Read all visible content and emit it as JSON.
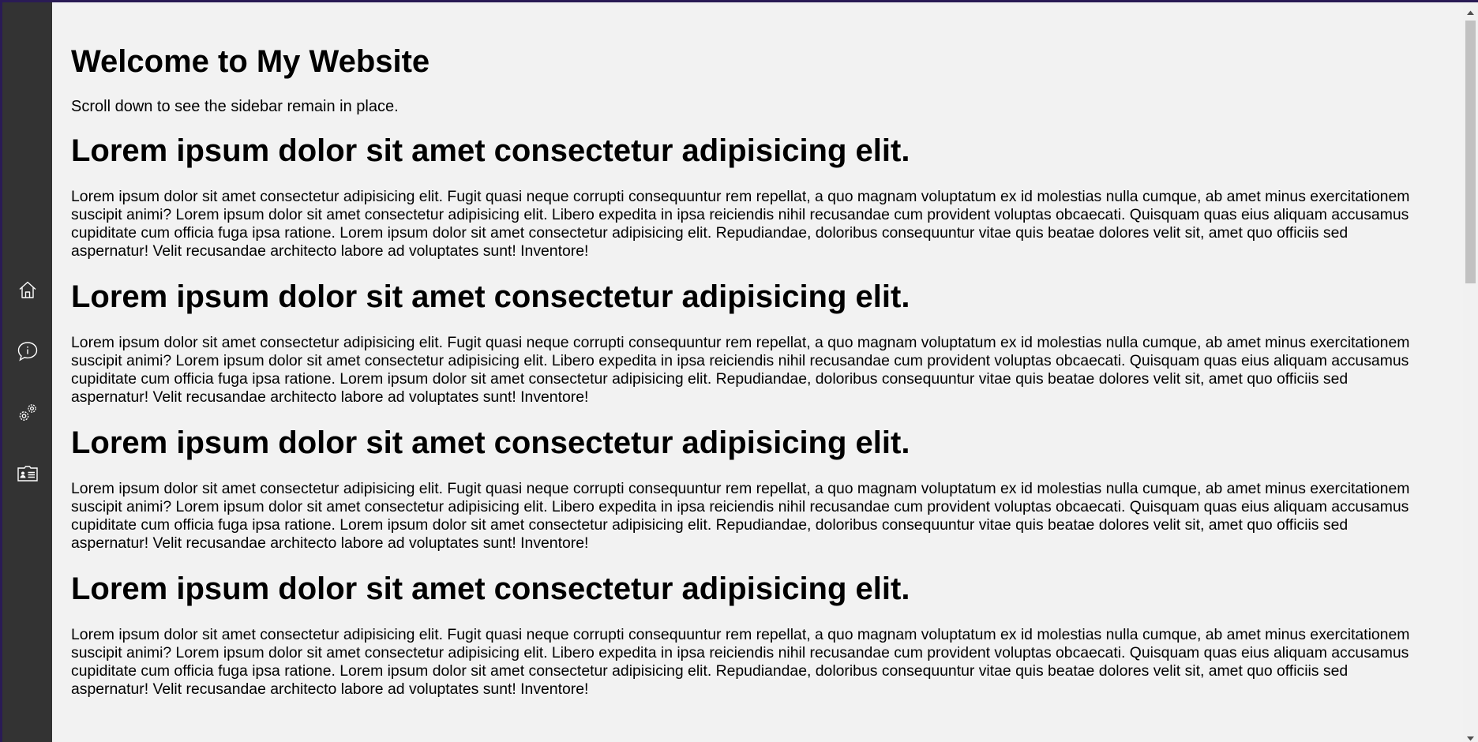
{
  "page": {
    "title": "Welcome to My Website",
    "intro": "Scroll down to see the sidebar remain in place."
  },
  "sidebar": {
    "items": [
      {
        "icon": "home-icon"
      },
      {
        "icon": "info-icon"
      },
      {
        "icon": "gears-icon"
      },
      {
        "icon": "contact-card-icon"
      }
    ]
  },
  "sections": [
    {
      "heading": "Lorem ipsum dolor sit amet consectetur adipisicing elit.",
      "body": "Lorem ipsum dolor sit amet consectetur adipisicing elit. Fugit quasi neque corrupti consequuntur rem repellat, a quo magnam voluptatum ex id molestias nulla cumque, ab amet minus exercitationem suscipit animi? Lorem ipsum dolor sit amet consectetur adipisicing elit. Libero expedita in ipsa reiciendis nihil recusandae cum provident voluptas obcaecati. Quisquam quas eius aliquam accusamus cupiditate cum officia fuga ipsa ratione. Lorem ipsum dolor sit amet consectetur adipisicing elit. Repudiandae, doloribus consequuntur vitae quis beatae dolores velit sit, amet quo officiis sed aspernatur! Velit recusandae architecto labore ad voluptates sunt! Inventore!"
    },
    {
      "heading": "Lorem ipsum dolor sit amet consectetur adipisicing elit.",
      "body": "Lorem ipsum dolor sit amet consectetur adipisicing elit. Fugit quasi neque corrupti consequuntur rem repellat, a quo magnam voluptatum ex id molestias nulla cumque, ab amet minus exercitationem suscipit animi? Lorem ipsum dolor sit amet consectetur adipisicing elit. Libero expedita in ipsa reiciendis nihil recusandae cum provident voluptas obcaecati. Quisquam quas eius aliquam accusamus cupiditate cum officia fuga ipsa ratione. Lorem ipsum dolor sit amet consectetur adipisicing elit. Repudiandae, doloribus consequuntur vitae quis beatae dolores velit sit, amet quo officiis sed aspernatur! Velit recusandae architecto labore ad voluptates sunt! Inventore!"
    },
    {
      "heading": "Lorem ipsum dolor sit amet consectetur adipisicing elit.",
      "body": "Lorem ipsum dolor sit amet consectetur adipisicing elit. Fugit quasi neque corrupti consequuntur rem repellat, a quo magnam voluptatum ex id molestias nulla cumque, ab amet minus exercitationem suscipit animi? Lorem ipsum dolor sit amet consectetur adipisicing elit. Libero expedita in ipsa reiciendis nihil recusandae cum provident voluptas obcaecati. Quisquam quas eius aliquam accusamus cupiditate cum officia fuga ipsa ratione. Lorem ipsum dolor sit amet consectetur adipisicing elit. Repudiandae, doloribus consequuntur vitae quis beatae dolores velit sit, amet quo officiis sed aspernatur! Velit recusandae architecto labore ad voluptates sunt! Inventore!"
    },
    {
      "heading": "Lorem ipsum dolor sit amet consectetur adipisicing elit.",
      "body": "Lorem ipsum dolor sit amet consectetur adipisicing elit. Fugit quasi neque corrupti consequuntur rem repellat, a quo magnam voluptatum ex id molestias nulla cumque, ab amet minus exercitationem suscipit animi? Lorem ipsum dolor sit amet consectetur adipisicing elit. Libero expedita in ipsa reiciendis nihil recusandae cum provident voluptas obcaecati. Quisquam quas eius aliquam accusamus cupiditate cum officia fuga ipsa ratione. Lorem ipsum dolor sit amet consectetur adipisicing elit. Repudiandae, doloribus consequuntur vitae quis beatae dolores velit sit, amet quo officiis sed aspernatur! Velit recusandae architecto labore ad voluptates sunt! Inventore!"
    }
  ],
  "colors": {
    "sidebar": "#333333",
    "background": "#f2f2f2",
    "window_border": "#2a1b55",
    "scroll_thumb": "#c1c1c1"
  }
}
